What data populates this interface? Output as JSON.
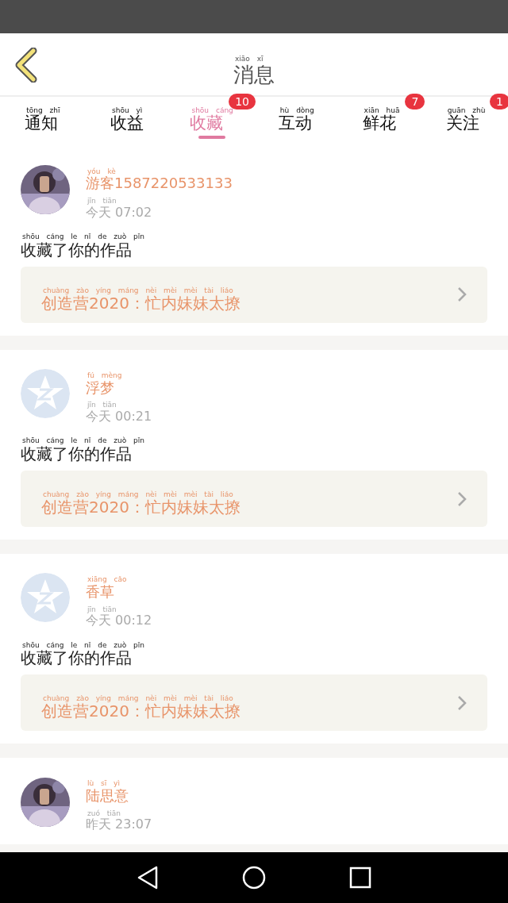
{
  "header": {
    "title": {
      "text": "消息",
      "pinyin": "xiāo xī"
    }
  },
  "tabs": [
    {
      "label": {
        "text": "通知",
        "pinyin": "tōng zhī"
      },
      "selected": false
    },
    {
      "label": {
        "text": "收益",
        "pinyin": "shōu yì"
      },
      "selected": false
    },
    {
      "label": {
        "text": "收藏",
        "pinyin": "shōu cáng"
      },
      "selected": true,
      "badge": "10"
    },
    {
      "label": {
        "text": "互动",
        "pinyin": "hù dòng"
      },
      "selected": false
    },
    {
      "label": {
        "text": "鲜花",
        "pinyin": "xiān huā"
      },
      "selected": false,
      "badge": "7"
    },
    {
      "label": {
        "text": "关注",
        "pinyin": "guān zhù"
      },
      "selected": false,
      "badge": "1"
    }
  ],
  "messages": [
    {
      "name": {
        "text": "游客1587220533133",
        "pinyin": "yóu kè"
      },
      "time": {
        "text": "今天 07:02",
        "pinyin": "jīn tiān"
      },
      "action": {
        "text": "收藏了你的作品",
        "pinyin": "shōu cáng le nǐ de zuò pǐn"
      },
      "work": {
        "text": "创造营2020：忙内妹妹太撩",
        "pinyin": "chuàng zào yíng máng nèi mèi mèi tài liáo"
      }
    },
    {
      "avatar": {
        "kind": "default"
      },
      "name": {
        "text": "浮梦",
        "pinyin": "fú mèng"
      },
      "time": {
        "text": "今天 00:21",
        "pinyin": "jīn tiān"
      },
      "action": {
        "text": "收藏了你的作品",
        "pinyin": "shōu cáng le nǐ de zuò pǐn"
      },
      "work": {
        "text": "创造营2020：忙内妹妹太撩",
        "pinyin": "chuàng zào yíng máng nèi mèi mèi tài liáo"
      }
    },
    {
      "avatar": {
        "kind": "default"
      },
      "name": {
        "text": "香草",
        "pinyin": "xiāng cǎo"
      },
      "time": {
        "text": "今天 00:12",
        "pinyin": "jīn tiān"
      },
      "action": {
        "text": "收藏了你的作品",
        "pinyin": "shōu cáng le nǐ de zuò pǐn"
      },
      "work": {
        "text": "创造营2020：忙内妹妹太撩",
        "pinyin": "chuàng zào yíng máng nèi mèi mèi tài liáo"
      }
    },
    {
      "name": {
        "text": "陆思意",
        "pinyin": "lù sī yì"
      },
      "time": {
        "text": "昨天 23:07",
        "pinyin": "zuó tiān"
      }
    }
  ]
}
